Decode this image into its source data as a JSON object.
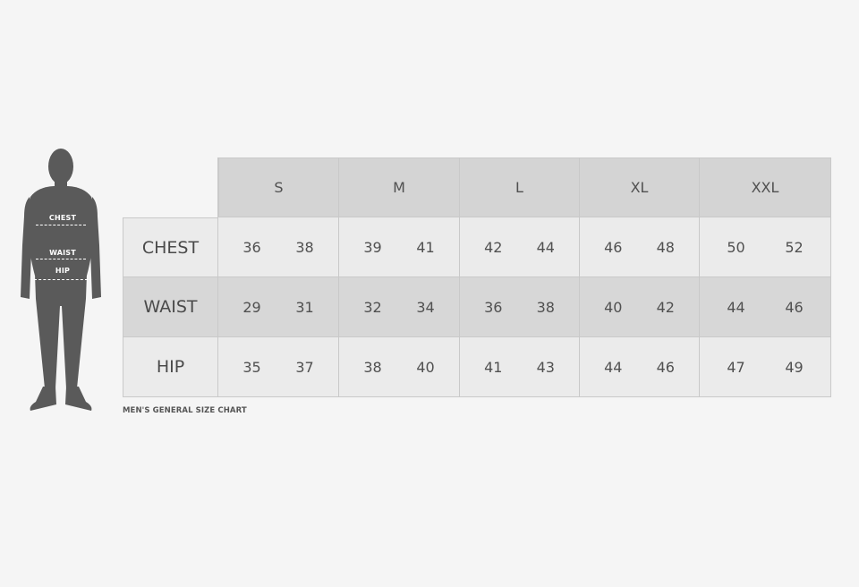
{
  "chart_data": {
    "type": "table",
    "columns": [
      "S",
      "M",
      "L",
      "XL",
      "XXL"
    ],
    "rows": [
      {
        "label": "CHEST",
        "values": [
          [
            36,
            38
          ],
          [
            39,
            41
          ],
          [
            42,
            44
          ],
          [
            46,
            48
          ],
          [
            50,
            52
          ]
        ]
      },
      {
        "label": "WAIST",
        "values": [
          [
            29,
            31
          ],
          [
            32,
            34
          ],
          [
            36,
            38
          ],
          [
            40,
            42
          ],
          [
            44,
            46
          ]
        ]
      },
      {
        "label": "HIP",
        "values": [
          [
            35,
            37
          ],
          [
            38,
            40
          ],
          [
            41,
            43
          ],
          [
            44,
            46
          ],
          [
            47,
            49
          ]
        ]
      }
    ],
    "caption": "MEN'S GENERAL SIZE CHART"
  },
  "figure": {
    "labels": {
      "chest": "CHEST",
      "waist": "WAIST",
      "hip": "HIP"
    }
  },
  "colors": {
    "header_bg": "#d4d4d4",
    "row_light": "#ebebeb",
    "row_dark": "#d7d7d7",
    "figure": "#5a5a5a"
  }
}
